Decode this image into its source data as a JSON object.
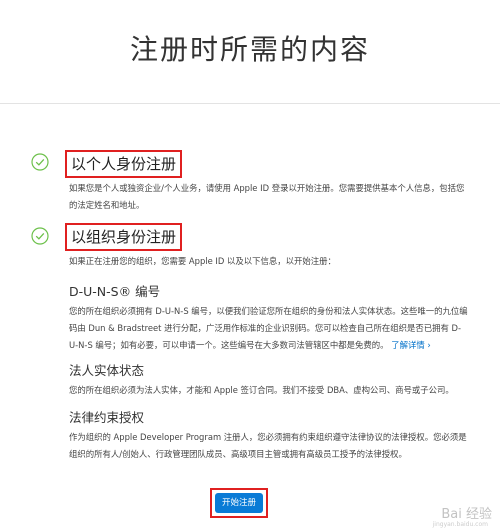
{
  "page": {
    "title": "注册时所需的内容"
  },
  "individual": {
    "title": "以个人身份注册",
    "description": "如果您是个人或独资企业/个人业务，请使用 Apple ID 登录以开始注册。您需要提供基本个人信息，包括您的法定姓名和地址。"
  },
  "organization": {
    "title": "以组织身份注册",
    "intro": "如果正在注册您的组织，您需要 Apple ID 以及以下信息，以开始注册：",
    "duns": {
      "heading": "D-U-N-S® 编号",
      "text": "您的所在组织必须拥有 D-U-N-S 编号，以便我们验证您所在组织的身份和法人实体状态。这些唯一的九位编码由 Dun & Bradstreet 进行分配，广泛用作标准的企业识别码。您可以检查自己所在组织是否已拥有 D-U-N-S 编号；如有必要，可以申请一个。这些编号在大多数司法管辖区中都是免费的。",
      "link": "了解详情 ›"
    },
    "legal_entity": {
      "heading": "法人实体状态",
      "text": "您的所在组织必须为法人实体，才能和 Apple 签订合同。我们不接受 DBA、虚构公司、商号或子公司。"
    },
    "authority": {
      "heading": "法律约束授权",
      "text": "作为组织的 Apple Developer Program 注册人，您必须拥有约束组织遵守法律协议的法律授权。您必须是组织的所有人/创始人、行政管理团队成员、高级项目主管或拥有高级员工授予的法律授权。"
    }
  },
  "start_button": {
    "label": "开始注册"
  },
  "watermark": {
    "text": "Bai 经验",
    "sub": "jingyan.baidu.com"
  },
  "colors": {
    "accent": "#0a7bd6",
    "highlight": "#e02020",
    "check": "#6cc04a",
    "link": "#0070c9"
  },
  "icons": {
    "check": "circle-check-icon"
  }
}
